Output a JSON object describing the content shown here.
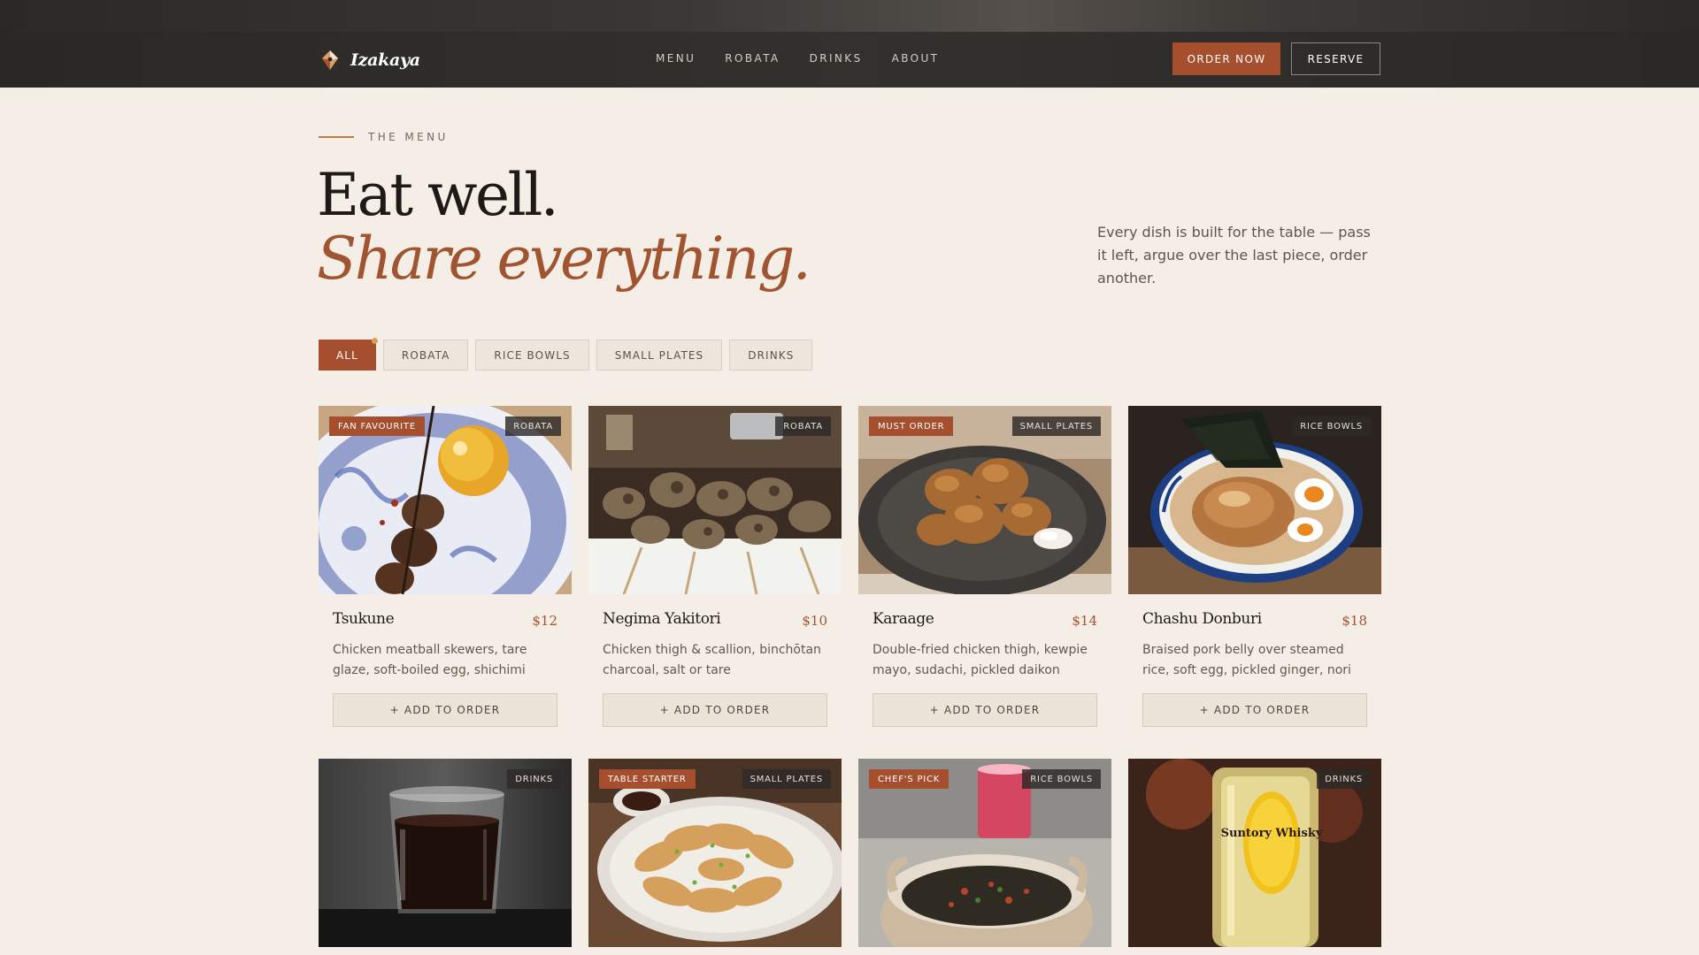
{
  "header": {
    "brand": "Izakaya",
    "nav": [
      "MENU",
      "ROBATA",
      "DRINKS",
      "ABOUT"
    ],
    "order_button": "ORDER NOW",
    "reserve_button": "RESERVE"
  },
  "hero": {
    "eyebrow": "THE MENU",
    "title": "Eat well.",
    "subtitle": "Share everything.",
    "description": "Every dish is built for the table — pass it left, argue over the last piece, order another."
  },
  "filters": [
    "ALL",
    "ROBATA",
    "RICE BOWLS",
    "SMALL PLATES",
    "DRINKS"
  ],
  "active_filter": "ALL",
  "colors": {
    "accent": "#a64f2e",
    "background": "#f4eee7",
    "nav_bg": "#2f2d2b",
    "dot": "#d3a34f"
  },
  "menu": [
    {
      "name": "Tsukune",
      "price": "$12",
      "badge": "FAN FAVOURITE",
      "category": "ROBATA",
      "description": "Chicken meatball skewers, tare glaze, soft-boiled egg, shichimi",
      "button": "+ ADD TO ORDER"
    },
    {
      "name": "Negima Yakitori",
      "price": "$10",
      "badge": "",
      "category": "ROBATA",
      "description": "Chicken thigh & scallion, binchōtan charcoal, salt or tare",
      "button": "+ ADD TO ORDER"
    },
    {
      "name": "Karaage",
      "price": "$14",
      "badge": "MUST ORDER",
      "category": "SMALL PLATES",
      "description": "Double-fried chicken thigh, kewpie mayo, sudachi, pickled daikon",
      "button": "+ ADD TO ORDER"
    },
    {
      "name": "Chashu Donburi",
      "price": "$18",
      "badge": "",
      "category": "RICE BOWLS",
      "description": "Braised pork belly over steamed rice, soft egg, pickled ginger, nori",
      "button": "+ ADD TO ORDER"
    },
    {
      "badge": "",
      "category": "DRINKS"
    },
    {
      "badge": "TABLE STARTER",
      "category": "SMALL PLATES"
    },
    {
      "badge": "CHEF'S PICK",
      "category": "RICE BOWLS"
    },
    {
      "badge": "",
      "category": "DRINKS",
      "label_text": "Suntory Whisky"
    }
  ]
}
